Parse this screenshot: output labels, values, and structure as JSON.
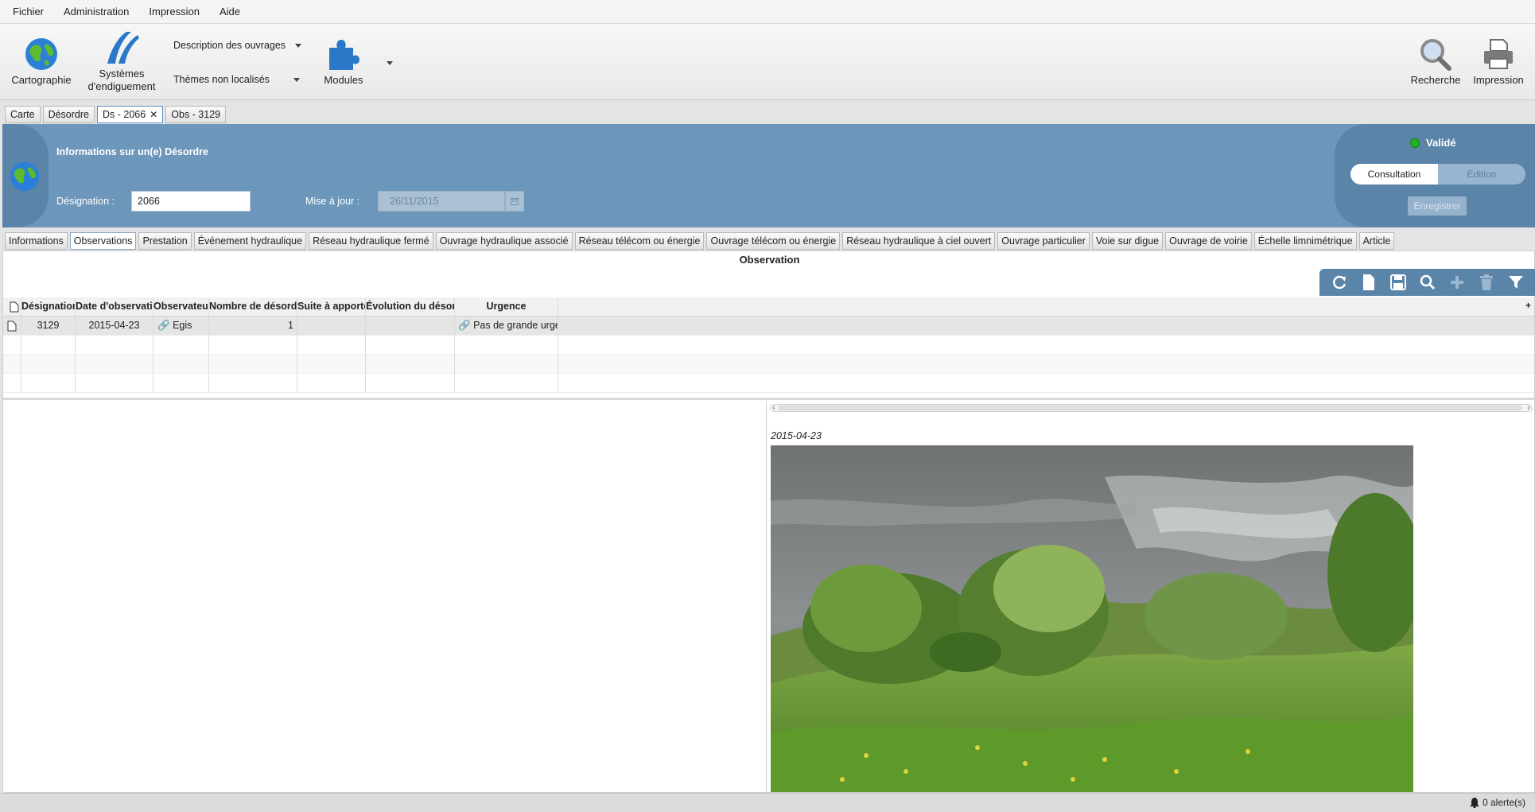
{
  "menu": [
    "Fichier",
    "Administration",
    "Impression",
    "Aide"
  ],
  "toolbar": {
    "cartographie": "Cartographie",
    "systemes_line1": "Systèmes",
    "systemes_line2": "d'endiguement",
    "desc_ouvrages": "Description des ouvrages",
    "themes": "Thèmes non localisés",
    "modules": "Modules",
    "recherche": "Recherche",
    "impression": "Impression"
  },
  "doc_tabs": {
    "carte": "Carte",
    "desordre": "Désordre",
    "ds": "Ds - 2066",
    "obs": "Obs - 3129"
  },
  "header": {
    "title": "Informations sur un(e) Désordre",
    "designation_label": "Désignation :",
    "designation_value": "2066",
    "maj_label": "Mise à jour :",
    "maj_value": "26/11/2015",
    "status": "Validé",
    "consultation": "Consultation",
    "edition": "Edition",
    "save": "Enregistrer"
  },
  "section_tabs": {
    "t0": "Informations",
    "t1": "Observations",
    "t2": "Prestation",
    "t3": "Événement hydraulique",
    "t4": "Réseau hydraulique fermé",
    "t5": "Ouvrage hydraulique associé",
    "t6": "Réseau télécom ou énergie",
    "t7": "Ouvrage télécom ou énergie",
    "t8": "Réseau hydraulique à ciel ouvert",
    "t9": "Ouvrage particulier",
    "t10": "Voie sur digue",
    "t11": "Ouvrage de voirie",
    "t12": "Échelle limnimétrique",
    "t13": "Article"
  },
  "observation_title": "Observation",
  "table": {
    "headers": {
      "designation": "Désignation",
      "date": "Date d'observation",
      "observateur": "Observateur",
      "nombre": "Nombre de désordres",
      "suite": "Suite à apporter",
      "evolution": "Évolution du désordre",
      "urgence": "Urgence"
    },
    "row1": {
      "designation": "3129",
      "date": "2015-04-23",
      "observateur": "Egis",
      "nombre": "1",
      "suite": "",
      "evolution": "",
      "urgence": "Pas de grande urgence"
    }
  },
  "photo": {
    "date": "2015-04-23"
  },
  "status": {
    "alerts": "0 alerte(s)"
  },
  "colors": {
    "header_blue": "#6c97bb",
    "header_dark": "#5a84a8",
    "valid_green": "#21b323"
  }
}
